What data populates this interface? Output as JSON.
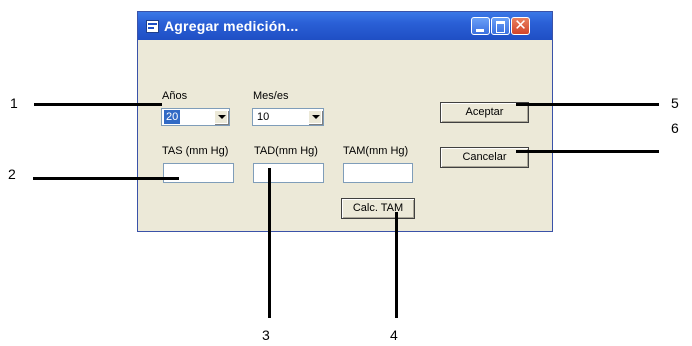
{
  "window": {
    "title": "Agregar medición...",
    "close_glyph": "✕"
  },
  "form": {
    "anos_label": "Años",
    "anos_value": "20",
    "meses_label": "Mes/es",
    "meses_value": "10",
    "tas_label": "TAS (mm Hg)",
    "tad_label": "TAD(mm Hg)",
    "tam_label": "TAM(mm Hg)",
    "tas_value": "",
    "tad_value": "",
    "tam_value": "",
    "calc_button": "Calc. TAM",
    "accept_button": "Aceptar",
    "cancel_button": "Cancelar"
  },
  "callouts": [
    "1",
    "2",
    "3",
    "4",
    "5",
    "6"
  ],
  "icons": {
    "window_icon": "app-window-icon",
    "minimize": "minimize-icon",
    "maximize": "maximize-icon",
    "close": "close-icon",
    "dropdown": "chevron-down-icon"
  },
  "colors": {
    "titlebar": "#2a5fd6",
    "window_bg": "#ece9d8",
    "selection": "#316ac5",
    "close_button": "#d2442a"
  }
}
